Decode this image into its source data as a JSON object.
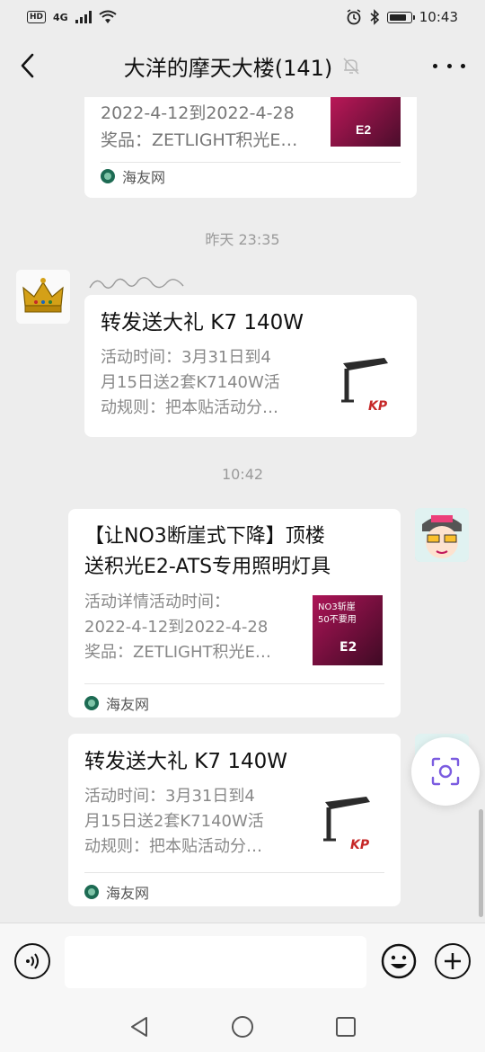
{
  "status_bar": {
    "hd": "HD",
    "network": "4G",
    "time": "10:43"
  },
  "header": {
    "title": "大洋的摩天大楼(141)"
  },
  "messages": [
    {
      "line1": "2022-4-12到2022-4-28",
      "line2": "奖品：ZETLIGHT积光E…",
      "source": "海友网",
      "thumb_text": "E2"
    },
    {
      "timestamp": "昨天 23:35",
      "title": "转发送大礼 K7 140W",
      "desc": [
        "活动时间：3月31日到4",
        "月15日送2套K7140W活",
        "动规则：把本贴活动分…"
      ],
      "thumb_text": "KP"
    },
    {
      "timestamp": "10:42",
      "title": [
        "【让NO3断崖式下降】顶楼",
        "送积光E2-ATS专用照明灯具"
      ],
      "desc": [
        "活动详情活动时间：",
        "2022-4-12到2022-4-28",
        "奖品：ZETLIGHT积光E…"
      ],
      "source": "海友网",
      "thumb_text": "E2",
      "thumb_banner": [
        "NO3斩崖",
        "50不要用"
      ]
    },
    {
      "title": "转发送大礼 K7 140W",
      "desc": [
        "活动时间：3月31日到4",
        "月15日送2套K7140W活",
        "动规则：把本贴活动分…"
      ],
      "source": "海友网",
      "thumb_text": "KP"
    }
  ],
  "colors": {
    "background": "#ededed",
    "card": "#ffffff",
    "muted_text": "#888888",
    "timestamp": "#9a9a9a",
    "accent_scan": "#7b5ce0"
  }
}
